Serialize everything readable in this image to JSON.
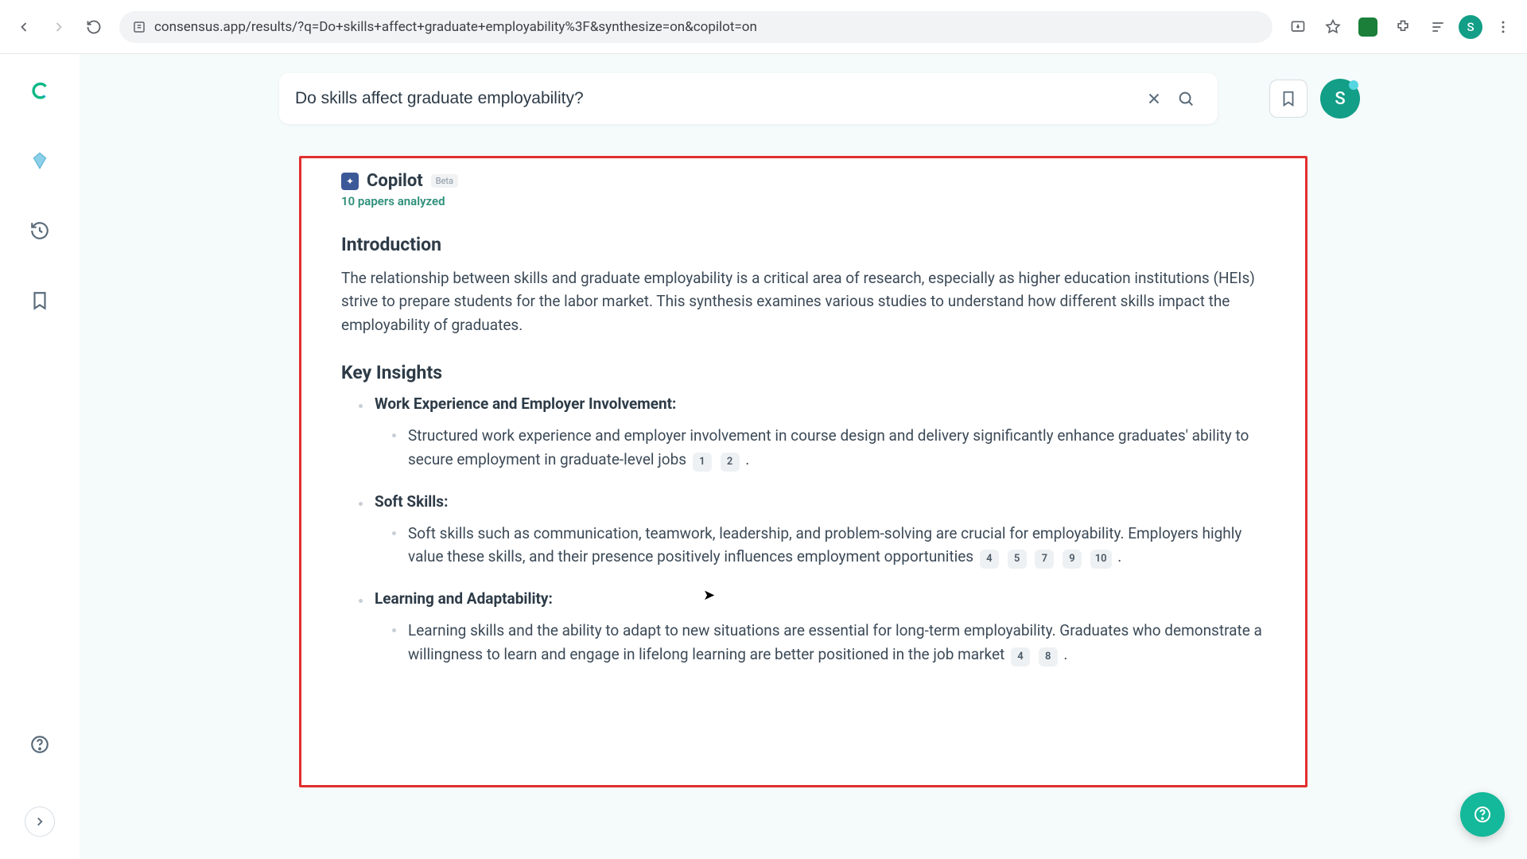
{
  "browser": {
    "url": "consensus.app/results/?q=Do+skills+affect+graduate+employability%3F&synthesize=on&copilot=on",
    "profile_initial": "S"
  },
  "search": {
    "value": "Do skills affect graduate employability?"
  },
  "avatar": {
    "initial": "S"
  },
  "copilot": {
    "title": "Copilot",
    "beta": "Beta",
    "papers": "10 papers analyzed",
    "intro_heading": "Introduction",
    "intro_body": "The relationship between skills and graduate employability is a critical area of research, especially as higher education institutions (HEIs) strive to prepare students for the labor market. This synthesis examines various studies to understand how different skills impact the employability of graduates.",
    "insights_heading": "Key Insights",
    "insights": [
      {
        "title": "Work Experience and Employer Involvement:",
        "body": "Structured work experience and employer involvement in course design and delivery significantly enhance graduates' ability to secure employment in graduate-level jobs",
        "cites": [
          "1",
          "2"
        ]
      },
      {
        "title": "Soft Skills:",
        "body": "Soft skills such as communication, teamwork, leadership, and problem-solving are crucial for employability. Employers highly value these skills, and their presence positively influences employment opportunities",
        "cites": [
          "4",
          "5",
          "7",
          "9",
          "10"
        ]
      },
      {
        "title": "Learning and Adaptability:",
        "body": "Learning skills and the ability to adapt to new situations are essential for long-term employability. Graduates who demonstrate a willingness to learn and engage in lifelong learning are better positioned in the job market",
        "cites": [
          "4",
          "8"
        ]
      }
    ]
  }
}
